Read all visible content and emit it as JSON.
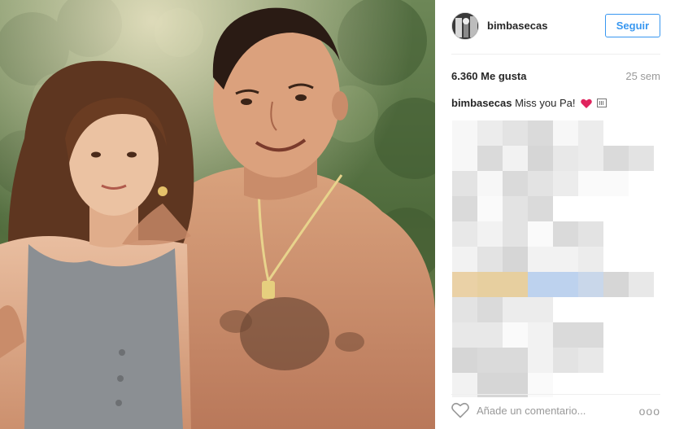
{
  "post": {
    "username": "bimbasecas",
    "follow_label": "Seguir",
    "likes": "6.360 Me gusta",
    "time_ago": "25 sem",
    "caption_user": "bimbasecas",
    "caption_text": "Miss you Pa!",
    "caption_emojis": [
      "heart-icon",
      "box-emoji-icon"
    ],
    "comment_placeholder": "Añade un comentario...",
    "more_label": "ooo"
  },
  "colors": {
    "accent": "#3897f0",
    "muted": "#999999",
    "text": "#262626",
    "divider": "#efefef",
    "heart": "#ed4956"
  }
}
